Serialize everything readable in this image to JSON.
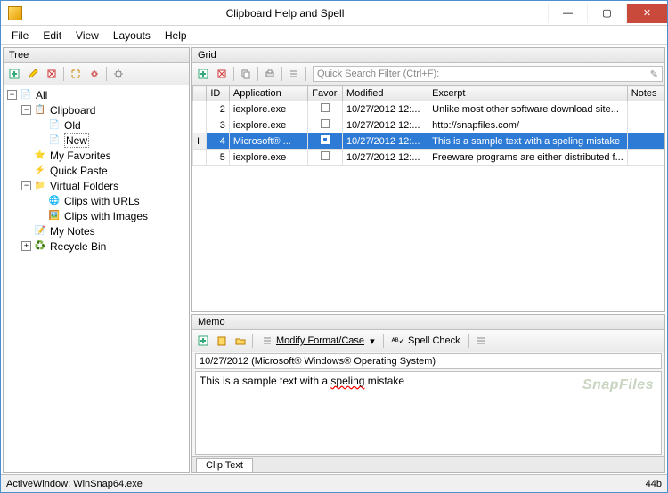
{
  "window": {
    "title": "Clipboard Help and Spell"
  },
  "menu": {
    "file": "File",
    "edit": "Edit",
    "view": "View",
    "layouts": "Layouts",
    "help": "Help"
  },
  "tree": {
    "header": "Tree",
    "nodes": {
      "all": "All",
      "clipboard": "Clipboard",
      "old": "Old",
      "new": "New",
      "favorites": "My Favorites",
      "quickpaste": "Quick Paste",
      "vfolders": "Virtual Folders",
      "clips_urls": "Clips with URLs",
      "clips_images": "Clips with Images",
      "mynotes": "My Notes",
      "recyclebin": "Recycle Bin"
    }
  },
  "grid": {
    "header": "Grid",
    "search_placeholder": "Quick Search Filter (Ctrl+F):",
    "columns": {
      "id": "ID",
      "application": "Application",
      "favor": "Favor",
      "modified": "Modified",
      "excerpt": "Excerpt",
      "notes": "Notes"
    },
    "rows": [
      {
        "id": "2",
        "app": "iexplore.exe",
        "fav": false,
        "modified": "10/27/2012 12:...",
        "excerpt": "Unlike most other software download site...",
        "notes": ""
      },
      {
        "id": "3",
        "app": "iexplore.exe",
        "fav": false,
        "modified": "10/27/2012 12:...",
        "excerpt": "http://snapfiles.com/",
        "notes": ""
      },
      {
        "id": "4",
        "app": "Microsoft® ...",
        "fav": true,
        "modified": "10/27/2012 12:...",
        "excerpt": "This is a sample text with a speling mistake",
        "notes": ""
      },
      {
        "id": "5",
        "app": "iexplore.exe",
        "fav": false,
        "modified": "10/27/2012 12:...",
        "excerpt": "Freeware programs are either distributed f...",
        "notes": ""
      }
    ]
  },
  "memo": {
    "header": "Memo",
    "modify_label": "Modify Format/Case",
    "spell_label": "Spell Check",
    "info_line": "10/27/2012 (Microsoft® Windows® Operating System)",
    "text_before": "This is a sample text with a ",
    "text_misspelled": "speling",
    "text_after": " mistake",
    "tab": "Clip Text",
    "watermark": "SnapFiles"
  },
  "status": {
    "left": "ActiveWindow: WinSnap64.exe",
    "right": "44b"
  }
}
